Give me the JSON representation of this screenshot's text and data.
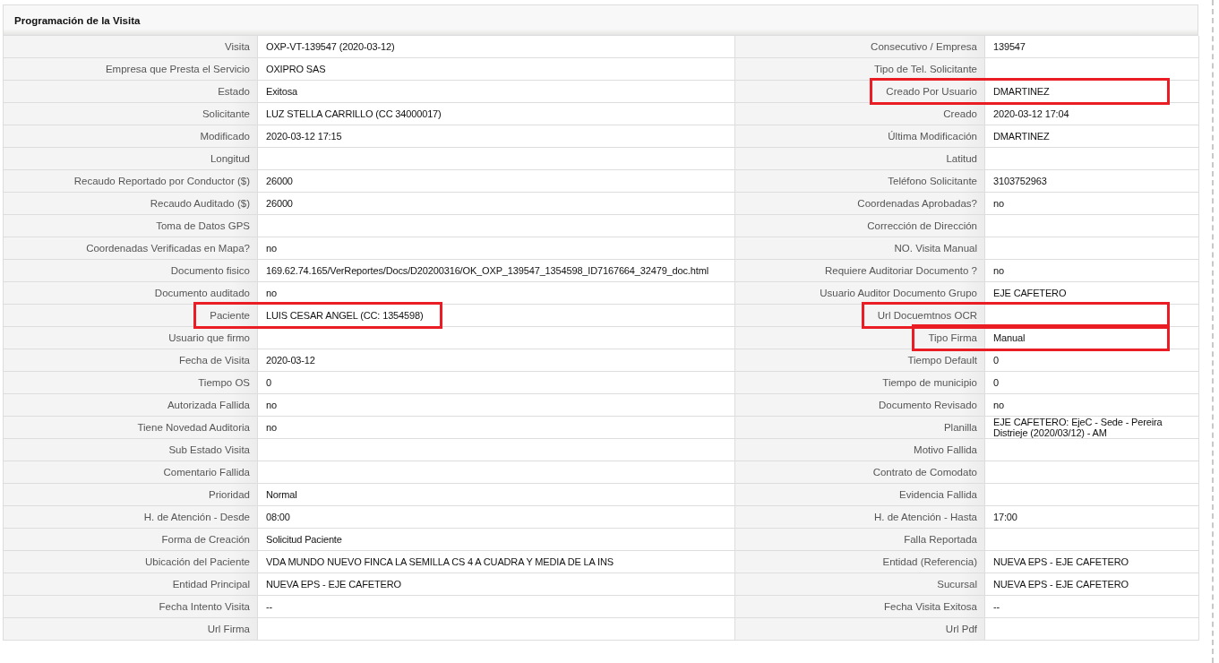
{
  "panel": {
    "title": "Programación de la Visita"
  },
  "rows": [
    {
      "left": {
        "label": "Visita",
        "value": "OXP-VT-139547 (2020-03-12)"
      },
      "right": {
        "label": "Consecutivo / Empresa",
        "value": "139547"
      }
    },
    {
      "left": {
        "label": "Empresa que Presta el Servicio",
        "value": "OXIPRO SAS"
      },
      "right": {
        "label": "Tipo de Tel. Solicitante"
      }
    },
    {
      "left": {
        "label": "Estado",
        "value": "Exitosa"
      },
      "right": {
        "label": "Creado Por Usuario",
        "value": "DMARTINEZ",
        "highlighted": true
      }
    },
    {
      "left": {
        "label": "Solicitante",
        "value": "LUZ STELLA CARRILLO (CC 34000017)"
      },
      "right": {
        "label": "Creado",
        "value": "2020-03-12 17:04"
      }
    },
    {
      "left": {
        "label": "Modificado",
        "value": "2020-03-12 17:15"
      },
      "right": {
        "label": "Última Modificación",
        "value": "DMARTINEZ"
      }
    },
    {
      "left": {
        "label": "Longitud"
      },
      "right": {
        "label": "Latitud"
      }
    },
    {
      "left": {
        "label": "Recaudo Reportado por Conductor ($)",
        "value": "26000"
      },
      "right": {
        "label": "Teléfono Solicitante",
        "value": "3103752963"
      }
    },
    {
      "left": {
        "label": "Recaudo Auditado ($)",
        "value": "26000"
      },
      "right": {
        "label": "Coordenadas Aprobadas?",
        "value": "no"
      }
    },
    {
      "left": {
        "label": "Toma de Datos GPS"
      },
      "right": {
        "label": "Corrección de Dirección"
      }
    },
    {
      "left": {
        "label": "Coordenadas Verificadas en Mapa?",
        "value": "no"
      },
      "right": {
        "label": "NO. Visita Manual"
      }
    },
    {
      "left": {
        "label": "Documento fisico",
        "value": "169.62.74.165/VerReportes/Docs/D20200316/OK_OXP_139547_1354598_ID7167664_32479_doc.html"
      },
      "right": {
        "label": "Requiere Auditoriar Documento ?",
        "value": "no"
      }
    },
    {
      "left": {
        "label": "Documento auditado",
        "value": "no"
      },
      "right": {
        "label": "Usuario Auditor Documento Grupo",
        "value": "EJE CAFETERO"
      }
    },
    {
      "left": {
        "label": "Paciente",
        "value": "LUIS CESAR ANGEL (CC: 1354598)",
        "highlighted": true
      },
      "right": {
        "label": "Url Docuemtnos OCR",
        "highlighted": true
      }
    },
    {
      "left": {
        "label": "Usuario que firmo"
      },
      "right": {
        "label": "Tipo Firma",
        "value": "Manual",
        "highlighted": true
      }
    },
    {
      "left": {
        "label": "Fecha de Visita",
        "value": "2020-03-12"
      },
      "right": {
        "label": "Tiempo Default",
        "value": "0"
      }
    },
    {
      "left": {
        "label": "Tiempo OS",
        "value": "0"
      },
      "right": {
        "label": "Tiempo de municipio",
        "value": "0"
      }
    },
    {
      "left": {
        "label": "Autorizada Fallida",
        "value": "no"
      },
      "right": {
        "label": "Documento Revisado",
        "value": "no"
      }
    },
    {
      "left": {
        "label": "Tiene Novedad Auditoria",
        "value": "no"
      },
      "right": {
        "label": "Planilla",
        "value": "EJE CAFETERO: EjeC - Sede - Pereira Distrieje (2020/03/12) - AM"
      }
    },
    {
      "left": {
        "label": "Sub Estado Visita"
      },
      "right": {
        "label": "Motivo Fallida"
      }
    },
    {
      "left": {
        "label": "Comentario Fallida"
      },
      "right": {
        "label": "Contrato de Comodato"
      }
    },
    {
      "left": {
        "label": "Prioridad",
        "value": "Normal"
      },
      "right": {
        "label": "Evidencia Fallida"
      }
    },
    {
      "left": {
        "label": "H. de Atención - Desde",
        "value": "08:00"
      },
      "right": {
        "label": "H. de Atención - Hasta",
        "value": "17:00"
      }
    },
    {
      "left": {
        "label": "Forma de Creación",
        "value": "Solicitud Paciente"
      },
      "right": {
        "label": "Falla Reportada"
      }
    },
    {
      "left": {
        "label": "Ubicación del Paciente",
        "value": "VDA MUNDO NUEVO FINCA LA SEMILLA CS 4 A CUADRA Y MEDIA DE LA INS"
      },
      "right": {
        "label": "Entidad (Referencia)",
        "value": "NUEVA EPS - EJE CAFETERO"
      }
    },
    {
      "left": {
        "label": "Entidad Principal",
        "value": "NUEVA EPS - EJE CAFETERO"
      },
      "right": {
        "label": "Sucursal",
        "value": "NUEVA EPS - EJE CAFETERO"
      }
    },
    {
      "left": {
        "label": "Fecha Intento Visita",
        "value": "--"
      },
      "right": {
        "label": "Fecha Visita Exitosa",
        "value": "--"
      }
    },
    {
      "left": {
        "label": "Url Firma"
      },
      "right": {
        "label": "Url Pdf"
      }
    }
  ]
}
